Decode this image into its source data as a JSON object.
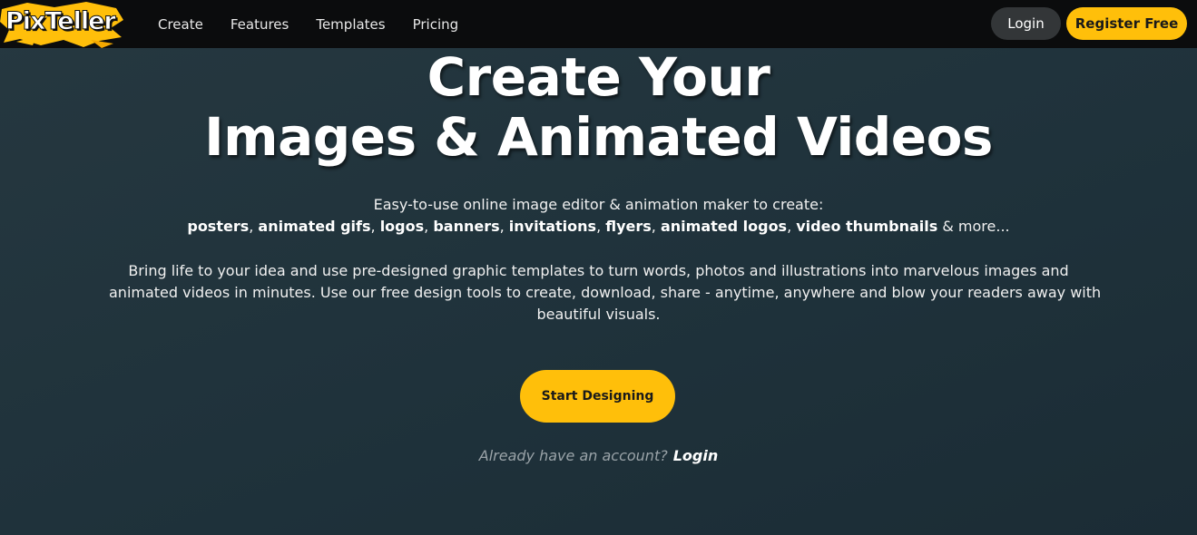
{
  "brand": {
    "name": "PixTeller",
    "accent_color": "#ffbf0a",
    "nav_background": "#0b0c0d"
  },
  "nav": {
    "links": [
      "Create",
      "Features",
      "Templates",
      "Pricing"
    ],
    "login_label": "Login",
    "register_label": "Register Free"
  },
  "hero": {
    "title_line1": "Create Your",
    "title_line2": "Images & Animated Videos",
    "subtitle_intro": "Easy-to-use online image editor & animation maker to create:",
    "subtitle_items": [
      "posters",
      "animated gifs",
      "logos",
      "banners",
      "invitations",
      "flyers",
      "animated logos",
      "video thumbnails"
    ],
    "subtitle_more": "& more...",
    "description_lines": [
      "Bring life to your idea and use pre-designed graphic templates to turn words, photos and illustrations into marvelous images and",
      "animated videos in minutes. Use our free design tools to create, download, share - anytime, anywhere and blow your readers away with",
      "beautiful visuals."
    ],
    "cta_label": "Start Designing",
    "account_prompt": "Already have an account?",
    "account_login_label": "Login"
  }
}
